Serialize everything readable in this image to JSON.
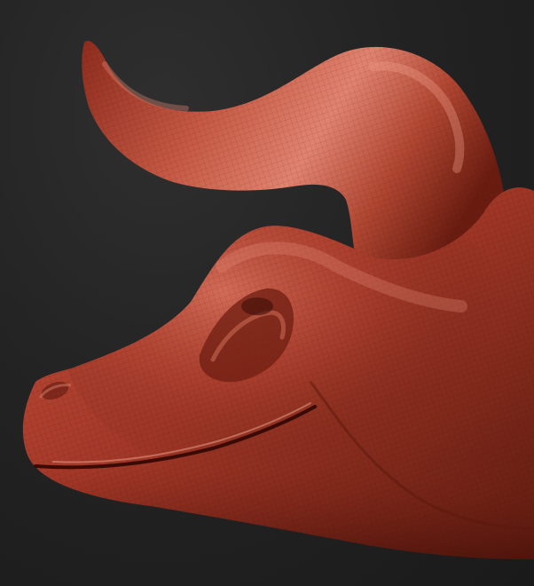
{
  "app": {
    "view": "3d-sculpt-viewport"
  },
  "viewport": {
    "background_color": "#232323",
    "model": {
      "subject": "horned-creature-head-sculpt",
      "material_color": "#a83a2a",
      "highlight_color": "#e07a66",
      "shadow_color": "#4a1208",
      "wireframe_overlay": true
    }
  }
}
